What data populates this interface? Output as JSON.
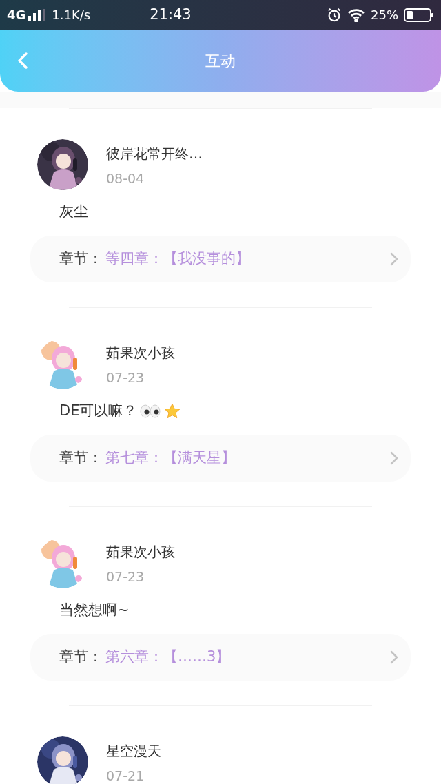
{
  "status_bar": {
    "network": "4G",
    "speed": "1.1K/s",
    "time": "21:43",
    "battery": "25%"
  },
  "header": {
    "title": "互动"
  },
  "items": [
    {
      "name": "彼岸花常开终…",
      "date": "08-04",
      "comment": "灰尘",
      "chapter_label": "章节：",
      "chapter": "等四章：【我没事的】"
    },
    {
      "name": "茹果次小孩",
      "date": "07-23",
      "comment": "DE可以嘛？",
      "emojis": [
        {
          "kind": "eyes"
        },
        {
          "kind": "star"
        }
      ],
      "chapter_label": "章节：",
      "chapter": "第七章：【满天星】"
    },
    {
      "name": "茹果次小孩",
      "date": "07-23",
      "comment": "当然想啊~",
      "chapter_label": "章节：",
      "chapter": "第六章：【……3】"
    },
    {
      "name": "星空漫天",
      "date": "07-21"
    }
  ]
}
